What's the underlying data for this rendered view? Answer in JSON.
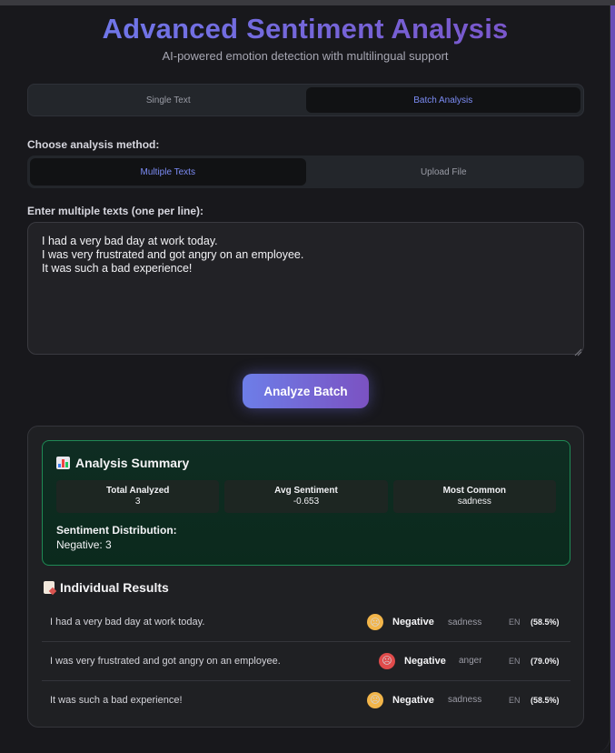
{
  "header": {
    "title": "Advanced Sentiment Analysis",
    "subtitle": "AI-powered emotion detection with multilingual support"
  },
  "mode_tabs": [
    {
      "label": "Single Text",
      "active": false
    },
    {
      "label": "Batch Analysis",
      "active": true
    }
  ],
  "method": {
    "label": "Choose analysis method:",
    "options": [
      {
        "label": "Multiple Texts",
        "active": true
      },
      {
        "label": "Upload File",
        "active": false
      }
    ]
  },
  "input": {
    "label": "Enter multiple texts (one per line):",
    "value": "I had a very bad day at work today.\nI was very frustrated and got angry on an employee.\nIt was such a bad experience!"
  },
  "analyze_button": "Analyze Batch",
  "summary": {
    "title": "Analysis Summary",
    "icon": "bar-chart-icon",
    "stats": [
      {
        "key": "Total Analyzed",
        "value": "3"
      },
      {
        "key": "Avg Sentiment",
        "value": "-0.653"
      },
      {
        "key": "Most Common",
        "value": "sadness"
      }
    ],
    "distribution_label": "Sentiment Distribution:",
    "distribution_value": "Negative: 3"
  },
  "results": {
    "title": "Individual Results",
    "icon": "memo-icon",
    "items": [
      {
        "text": "I had a very bad day at work today.",
        "emoji": "sad-face-icon",
        "sentiment": "Negative",
        "emotion": "sadness",
        "lang": "EN",
        "confidence": "(58.5%)"
      },
      {
        "text": "I was very frustrated and got angry on an employee.",
        "emoji": "angry-face-icon",
        "sentiment": "Negative",
        "emotion": "anger",
        "lang": "EN",
        "confidence": "(79.0%)"
      },
      {
        "text": "It was such a bad experience!",
        "emoji": "sad-face-icon",
        "sentiment": "Negative",
        "emotion": "sadness",
        "lang": "EN",
        "confidence": "(58.5%)"
      }
    ]
  },
  "colors": {
    "accent": "#7c8cf5",
    "success_border": "#1f8a55",
    "negative_emoji_sad": "#f2b54a",
    "negative_emoji_angry": "#e04b4b"
  }
}
